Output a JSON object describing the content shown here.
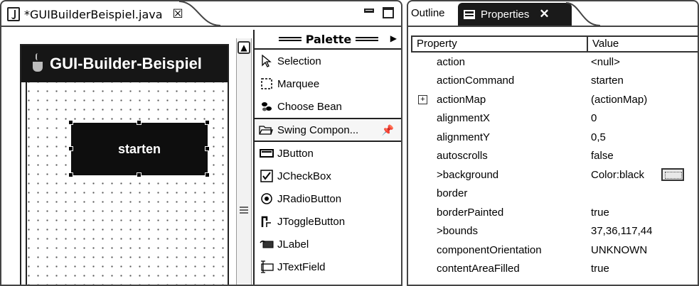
{
  "editor": {
    "tab_title": "*GUIBuilderBeispiel.java",
    "tab_close": "☒",
    "frame_title": "GUI-Builder-Beispiel",
    "button_label": "starten"
  },
  "palette": {
    "title": "Palette",
    "tools": [
      {
        "label": "Selection",
        "icon": "selection-arrow-icon"
      },
      {
        "label": "Marquee",
        "icon": "marquee-icon"
      },
      {
        "label": "Choose Bean",
        "icon": "choose-bean-icon"
      }
    ],
    "group_label": "Swing Compon...",
    "components": [
      {
        "label": "JButton",
        "icon": "jbutton-icon"
      },
      {
        "label": "JCheckBox",
        "icon": "jcheckbox-icon"
      },
      {
        "label": "JRadioButton",
        "icon": "jradiobutton-icon"
      },
      {
        "label": "JToggleButton",
        "icon": "jtogglebutton-icon"
      },
      {
        "label": "JLabel",
        "icon": "jlabel-icon"
      },
      {
        "label": "JTextField",
        "icon": "jtextfield-icon"
      }
    ]
  },
  "properties_view": {
    "tab_outline": "Outline",
    "tab_properties": "Properties",
    "col_property": "Property",
    "col_value": "Value",
    "rows": [
      {
        "name": "action",
        "value": "<null>"
      },
      {
        "name": "actionCommand",
        "value": "starten"
      },
      {
        "name": "actionMap",
        "value": "(actionMap)"
      },
      {
        "name": "alignmentX",
        "value": "0"
      },
      {
        "name": "alignmentY",
        "value": "0,5"
      },
      {
        "name": "autoscrolls",
        "value": "false"
      },
      {
        "name": ">background",
        "value": "Color:black"
      },
      {
        "name": "border",
        "value": ""
      },
      {
        "name": "borderPainted",
        "value": "true"
      },
      {
        "name": ">bounds",
        "value": "37,36,117,44"
      },
      {
        "name": "componentOrientation",
        "value": "UNKNOWN"
      },
      {
        "name": "contentAreaFilled",
        "value": "true"
      }
    ]
  }
}
